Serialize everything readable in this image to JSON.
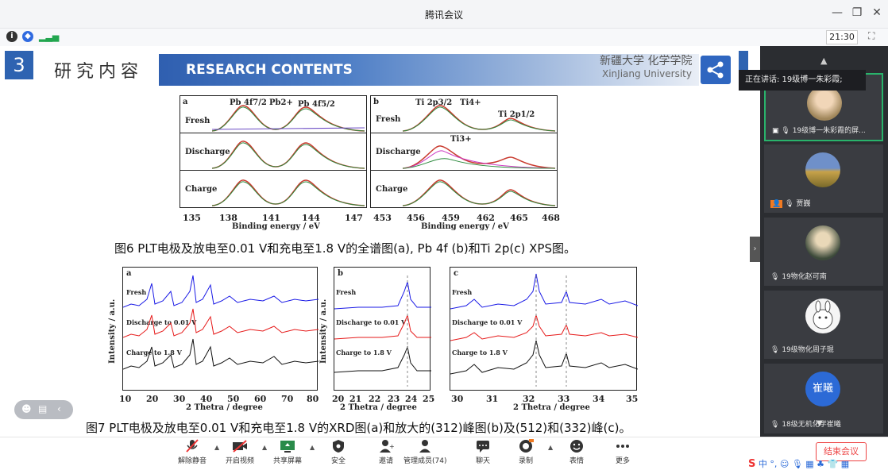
{
  "window": {
    "title": "腾讯会议"
  },
  "status": {
    "time": "21:30"
  },
  "slide": {
    "section_number": "3",
    "section_title": "研究内容",
    "banner": "RESEARCH CONTENTS",
    "university_cn": "新疆大学 化学学院",
    "university_en": "XinJiang University",
    "xps_a": {
      "letter": "a",
      "peaks": [
        "Pb 4f7/2",
        "Pb2+",
        "Pb 4f5/2"
      ],
      "rows": [
        "Fresh",
        "Discharge",
        "Charge"
      ],
      "ticks": [
        "135",
        "138",
        "141",
        "144",
        "147"
      ],
      "xlabel": "Binding energy / eV"
    },
    "xps_b": {
      "letter": "b",
      "peaks": [
        "Ti 2p3/2",
        "Ti4+",
        "Ti 2p1/2",
        "Ti3+"
      ],
      "rows": [
        "Fresh",
        "Discharge",
        "Charge"
      ],
      "ticks": [
        "453",
        "456",
        "459",
        "462",
        "465",
        "468"
      ],
      "xlabel": "Binding energy / eV"
    },
    "caption6": "图6 PLT电极及放电至0.01 V和充电至1.8 V的全谱图(a), Pb 4f (b)和Ti 2p(c) XPS图。",
    "xrd_a": {
      "letter": "a",
      "series": [
        "Fresh",
        "Discharge to 0.01 V",
        "Charge to 1.8 V"
      ],
      "ticks": [
        "10",
        "20",
        "30",
        "40",
        "50",
        "60",
        "70",
        "80"
      ],
      "xlabel": "2 Thetra / degree",
      "ylabel": "Intensity / a.u."
    },
    "xrd_b": {
      "letter": "b",
      "series": [
        "Fresh",
        "Discharge to 0.01 V",
        "Charge to 1.8 V"
      ],
      "ticks": [
        "20",
        "21",
        "22",
        "23",
        "24",
        "25"
      ],
      "xlabel": "2 Thetra / degree",
      "ylabel": "Intensity / a.u."
    },
    "xrd_c": {
      "letter": "c",
      "series": [
        "Fresh",
        "Discharge to 0.01 V",
        "Charge to 1.8 V"
      ],
      "ticks": [
        "30",
        "31",
        "32",
        "33",
        "34",
        "35"
      ],
      "xlabel": "2 Thetra / degree"
    },
    "caption7": "图7 PLT电极及放电至0.01 V和充电至1.8 V的XRD图(a)和放大的(312)峰图(b)及(512)和(332)峰(c)。"
  },
  "panel": {
    "speaking": "正在讲话: 19级博一朱彩霞;",
    "participants": [
      {
        "name": "19级博一朱彩霞的屏..."
      },
      {
        "name": "贾巍"
      },
      {
        "name": "19物化赵可南"
      },
      {
        "name": "19级物化周子琨"
      },
      {
        "name": "18级无机化学崔曦",
        "avatar_text": "崔曦"
      }
    ]
  },
  "toolbar": {
    "mute": "解除静音",
    "video": "开启视频",
    "share": "共享屏幕",
    "security": "安全",
    "invite": "邀请",
    "members": "管理成员(74)",
    "chat": "聊天",
    "record": "录制",
    "emoji": "表情",
    "more": "更多",
    "end": "结束会议"
  },
  "ime": {
    "text": "中 °, ☺ 🎙 ▦ ♣ 👕 ▦"
  }
}
